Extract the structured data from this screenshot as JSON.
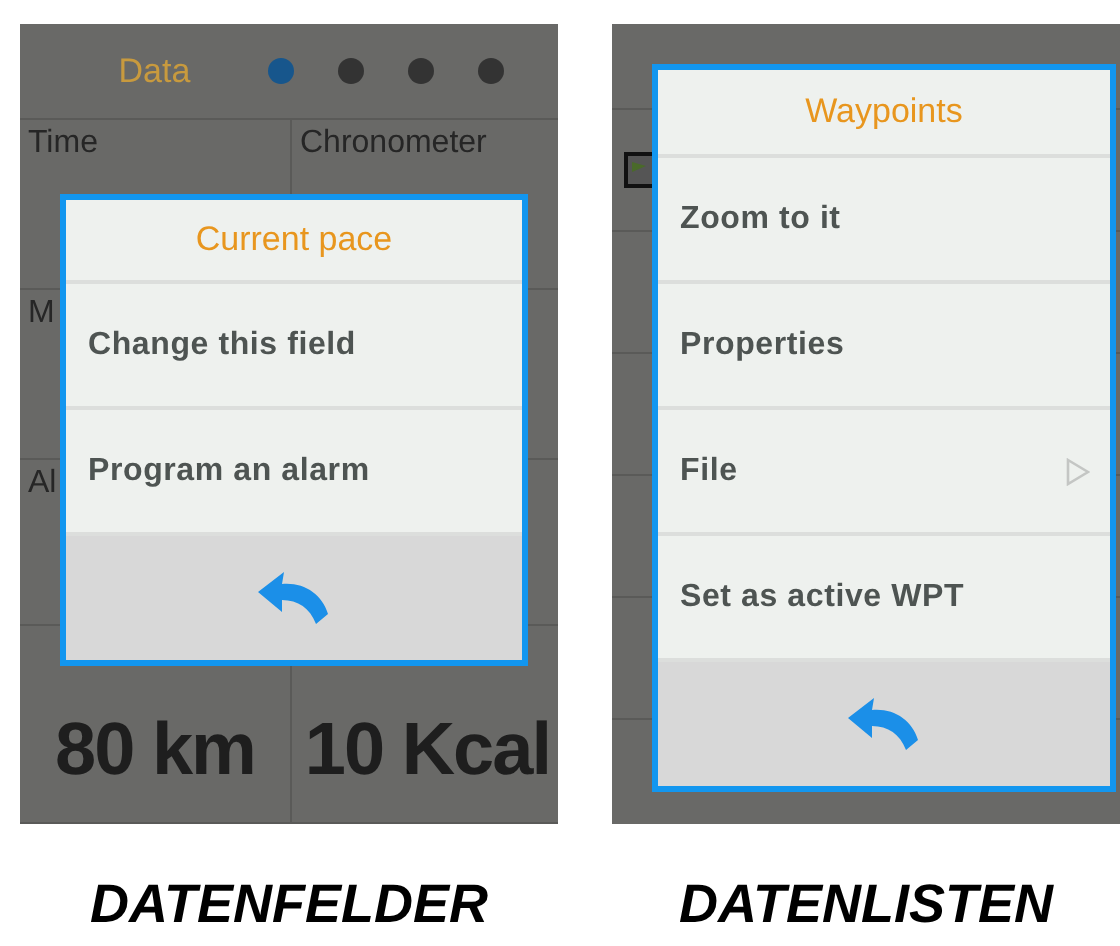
{
  "screens": [
    {
      "kind": "fields",
      "caption": "DATENFELDER",
      "header": {
        "title": "Data",
        "page_dots": [
          {
            "selected": true
          },
          {
            "selected": false
          },
          {
            "selected": false
          },
          {
            "selected": false
          }
        ]
      },
      "rows": [
        {
          "left": {
            "label": "Time"
          },
          "right": {
            "label": "Chronometer"
          }
        },
        {
          "left": {
            "label": "M"
          }
        },
        {
          "left": {
            "label": "Al"
          }
        },
        {
          "left": {
            "value": "80 km"
          },
          "right": {
            "value": "10 Kcal"
          }
        }
      ],
      "dialog": {
        "title": "Current pace",
        "items": [
          {
            "label": "Change this field",
            "submenu": false
          },
          {
            "label": "Program an alarm",
            "submenu": false
          }
        ]
      }
    },
    {
      "kind": "list",
      "caption": "DATENLISTEN",
      "dialog": {
        "title": "Waypoints",
        "items": [
          {
            "label": "Zoom to it",
            "submenu": false
          },
          {
            "label": "Properties",
            "submenu": false
          },
          {
            "label": "File",
            "submenu": true
          },
          {
            "label": "Set as active WPT",
            "submenu": false
          }
        ]
      }
    }
  ]
}
